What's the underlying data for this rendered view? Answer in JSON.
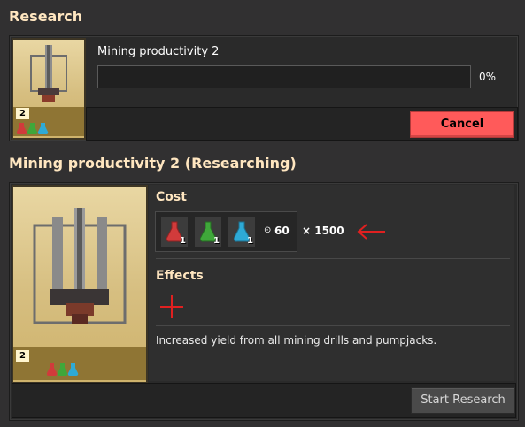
{
  "top": {
    "title": "Research",
    "tech_name": "Mining productivity 2",
    "progress_fraction": 0,
    "progress_text": "0%",
    "level": "2",
    "cancel_label": "Cancel"
  },
  "detail": {
    "title": "Mining productivity 2 (Researching)",
    "level": "2",
    "cost_label": "Cost",
    "ingredients": [
      {
        "name": "red-science-pack-icon",
        "count": "1",
        "color": "#d13b3b"
      },
      {
        "name": "green-science-pack-icon",
        "count": "1",
        "color": "#3fa73a"
      },
      {
        "name": "blue-science-pack-icon",
        "count": "1",
        "color": "#2eaad6"
      }
    ],
    "time": "60",
    "multiplier": "× 1500",
    "effects_label": "Effects",
    "description": "Increased yield from all mining drills and pumpjacks.",
    "start_label": "Start Research"
  },
  "colors": {
    "heading": "#ffe6c0",
    "cancel": "#ff5a5a",
    "annotation": "#e02020"
  }
}
